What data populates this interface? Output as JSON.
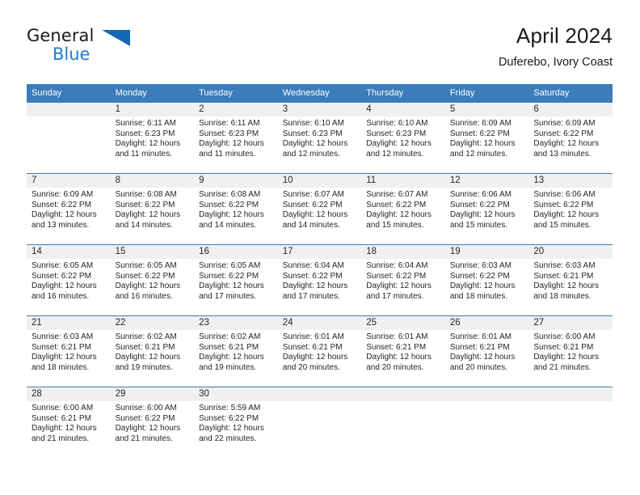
{
  "brand": {
    "name_part1": "General",
    "name_part2": "Blue",
    "triangle_color": "#1368b4",
    "blue_text_color": "#1b7fd4"
  },
  "header": {
    "title": "April 2024",
    "subtitle": "Duferebo, Ivory Coast"
  },
  "theme": {
    "header_blue": "#3b7cb9",
    "daynum_gray": "#f0f0f0",
    "text_color": "#262626"
  },
  "calendar": {
    "weekday_headers": [
      "Sunday",
      "Monday",
      "Tuesday",
      "Wednesday",
      "Thursday",
      "Friday",
      "Saturday"
    ],
    "weeks": [
      [
        {
          "day": "",
          "sunrise": "",
          "sunset": "",
          "daylight_line1": "",
          "daylight_line2": "",
          "empty": true
        },
        {
          "day": "1",
          "sunrise": "Sunrise: 6:11 AM",
          "sunset": "Sunset: 6:23 PM",
          "daylight_line1": "Daylight: 12 hours",
          "daylight_line2": "and 11 minutes.",
          "empty": false
        },
        {
          "day": "2",
          "sunrise": "Sunrise: 6:11 AM",
          "sunset": "Sunset: 6:23 PM",
          "daylight_line1": "Daylight: 12 hours",
          "daylight_line2": "and 11 minutes.",
          "empty": false
        },
        {
          "day": "3",
          "sunrise": "Sunrise: 6:10 AM",
          "sunset": "Sunset: 6:23 PM",
          "daylight_line1": "Daylight: 12 hours",
          "daylight_line2": "and 12 minutes.",
          "empty": false
        },
        {
          "day": "4",
          "sunrise": "Sunrise: 6:10 AM",
          "sunset": "Sunset: 6:23 PM",
          "daylight_line1": "Daylight: 12 hours",
          "daylight_line2": "and 12 minutes.",
          "empty": false
        },
        {
          "day": "5",
          "sunrise": "Sunrise: 6:09 AM",
          "sunset": "Sunset: 6:22 PM",
          "daylight_line1": "Daylight: 12 hours",
          "daylight_line2": "and 12 minutes.",
          "empty": false
        },
        {
          "day": "6",
          "sunrise": "Sunrise: 6:09 AM",
          "sunset": "Sunset: 6:22 PM",
          "daylight_line1": "Daylight: 12 hours",
          "daylight_line2": "and 13 minutes.",
          "empty": false
        }
      ],
      [
        {
          "day": "7",
          "sunrise": "Sunrise: 6:09 AM",
          "sunset": "Sunset: 6:22 PM",
          "daylight_line1": "Daylight: 12 hours",
          "daylight_line2": "and 13 minutes.",
          "empty": false
        },
        {
          "day": "8",
          "sunrise": "Sunrise: 6:08 AM",
          "sunset": "Sunset: 6:22 PM",
          "daylight_line1": "Daylight: 12 hours",
          "daylight_line2": "and 14 minutes.",
          "empty": false
        },
        {
          "day": "9",
          "sunrise": "Sunrise: 6:08 AM",
          "sunset": "Sunset: 6:22 PM",
          "daylight_line1": "Daylight: 12 hours",
          "daylight_line2": "and 14 minutes.",
          "empty": false
        },
        {
          "day": "10",
          "sunrise": "Sunrise: 6:07 AM",
          "sunset": "Sunset: 6:22 PM",
          "daylight_line1": "Daylight: 12 hours",
          "daylight_line2": "and 14 minutes.",
          "empty": false
        },
        {
          "day": "11",
          "sunrise": "Sunrise: 6:07 AM",
          "sunset": "Sunset: 6:22 PM",
          "daylight_line1": "Daylight: 12 hours",
          "daylight_line2": "and 15 minutes.",
          "empty": false
        },
        {
          "day": "12",
          "sunrise": "Sunrise: 6:06 AM",
          "sunset": "Sunset: 6:22 PM",
          "daylight_line1": "Daylight: 12 hours",
          "daylight_line2": "and 15 minutes.",
          "empty": false
        },
        {
          "day": "13",
          "sunrise": "Sunrise: 6:06 AM",
          "sunset": "Sunset: 6:22 PM",
          "daylight_line1": "Daylight: 12 hours",
          "daylight_line2": "and 15 minutes.",
          "empty": false
        }
      ],
      [
        {
          "day": "14",
          "sunrise": "Sunrise: 6:05 AM",
          "sunset": "Sunset: 6:22 PM",
          "daylight_line1": "Daylight: 12 hours",
          "daylight_line2": "and 16 minutes.",
          "empty": false
        },
        {
          "day": "15",
          "sunrise": "Sunrise: 6:05 AM",
          "sunset": "Sunset: 6:22 PM",
          "daylight_line1": "Daylight: 12 hours",
          "daylight_line2": "and 16 minutes.",
          "empty": false
        },
        {
          "day": "16",
          "sunrise": "Sunrise: 6:05 AM",
          "sunset": "Sunset: 6:22 PM",
          "daylight_line1": "Daylight: 12 hours",
          "daylight_line2": "and 17 minutes.",
          "empty": false
        },
        {
          "day": "17",
          "sunrise": "Sunrise: 6:04 AM",
          "sunset": "Sunset: 6:22 PM",
          "daylight_line1": "Daylight: 12 hours",
          "daylight_line2": "and 17 minutes.",
          "empty": false
        },
        {
          "day": "18",
          "sunrise": "Sunrise: 6:04 AM",
          "sunset": "Sunset: 6:22 PM",
          "daylight_line1": "Daylight: 12 hours",
          "daylight_line2": "and 17 minutes.",
          "empty": false
        },
        {
          "day": "19",
          "sunrise": "Sunrise: 6:03 AM",
          "sunset": "Sunset: 6:22 PM",
          "daylight_line1": "Daylight: 12 hours",
          "daylight_line2": "and 18 minutes.",
          "empty": false
        },
        {
          "day": "20",
          "sunrise": "Sunrise: 6:03 AM",
          "sunset": "Sunset: 6:21 PM",
          "daylight_line1": "Daylight: 12 hours",
          "daylight_line2": "and 18 minutes.",
          "empty": false
        }
      ],
      [
        {
          "day": "21",
          "sunrise": "Sunrise: 6:03 AM",
          "sunset": "Sunset: 6:21 PM",
          "daylight_line1": "Daylight: 12 hours",
          "daylight_line2": "and 18 minutes.",
          "empty": false
        },
        {
          "day": "22",
          "sunrise": "Sunrise: 6:02 AM",
          "sunset": "Sunset: 6:21 PM",
          "daylight_line1": "Daylight: 12 hours",
          "daylight_line2": "and 19 minutes.",
          "empty": false
        },
        {
          "day": "23",
          "sunrise": "Sunrise: 6:02 AM",
          "sunset": "Sunset: 6:21 PM",
          "daylight_line1": "Daylight: 12 hours",
          "daylight_line2": "and 19 minutes.",
          "empty": false
        },
        {
          "day": "24",
          "sunrise": "Sunrise: 6:01 AM",
          "sunset": "Sunset: 6:21 PM",
          "daylight_line1": "Daylight: 12 hours",
          "daylight_line2": "and 20 minutes.",
          "empty": false
        },
        {
          "day": "25",
          "sunrise": "Sunrise: 6:01 AM",
          "sunset": "Sunset: 6:21 PM",
          "daylight_line1": "Daylight: 12 hours",
          "daylight_line2": "and 20 minutes.",
          "empty": false
        },
        {
          "day": "26",
          "sunrise": "Sunrise: 6:01 AM",
          "sunset": "Sunset: 6:21 PM",
          "daylight_line1": "Daylight: 12 hours",
          "daylight_line2": "and 20 minutes.",
          "empty": false
        },
        {
          "day": "27",
          "sunrise": "Sunrise: 6:00 AM",
          "sunset": "Sunset: 6:21 PM",
          "daylight_line1": "Daylight: 12 hours",
          "daylight_line2": "and 21 minutes.",
          "empty": false
        }
      ],
      [
        {
          "day": "28",
          "sunrise": "Sunrise: 6:00 AM",
          "sunset": "Sunset: 6:21 PM",
          "daylight_line1": "Daylight: 12 hours",
          "daylight_line2": "and 21 minutes.",
          "empty": false
        },
        {
          "day": "29",
          "sunrise": "Sunrise: 6:00 AM",
          "sunset": "Sunset: 6:22 PM",
          "daylight_line1": "Daylight: 12 hours",
          "daylight_line2": "and 21 minutes.",
          "empty": false
        },
        {
          "day": "30",
          "sunrise": "Sunrise: 5:59 AM",
          "sunset": "Sunset: 6:22 PM",
          "daylight_line1": "Daylight: 12 hours",
          "daylight_line2": "and 22 minutes.",
          "empty": false
        },
        {
          "day": "",
          "sunrise": "",
          "sunset": "",
          "daylight_line1": "",
          "daylight_line2": "",
          "empty": true
        },
        {
          "day": "",
          "sunrise": "",
          "sunset": "",
          "daylight_line1": "",
          "daylight_line2": "",
          "empty": true
        },
        {
          "day": "",
          "sunrise": "",
          "sunset": "",
          "daylight_line1": "",
          "daylight_line2": "",
          "empty": true
        },
        {
          "day": "",
          "sunrise": "",
          "sunset": "",
          "daylight_line1": "",
          "daylight_line2": "",
          "empty": true
        }
      ]
    ]
  }
}
